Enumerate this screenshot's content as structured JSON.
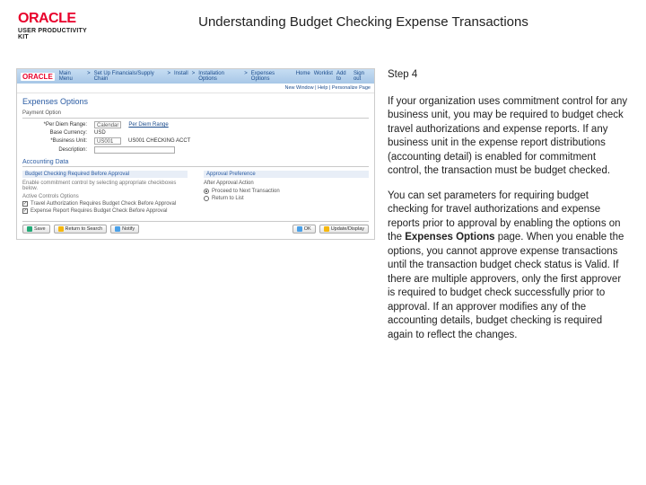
{
  "header": {
    "brand": "ORACLE",
    "subbrand": "USER PRODUCTIVITY KIT",
    "title": "Understanding Budget Checking Expense Transactions"
  },
  "instruction": {
    "step_label": "Step 4",
    "para1": "If your organization uses commitment control for any business unit, you may be required to budget check travel authorizations and expense reports. If any business unit in the expense report distributions (accounting detail) is enabled for commitment control, the transaction must be budget checked.",
    "para2a": "You can set parameters for requiring budget checking for travel authorizations and expense reports prior to approval by enabling the options on the ",
    "para2b": "Expenses Options",
    "para2c": " page. When you enable the options, you cannot approve expense transactions until the transaction budget check status is Valid. If there are multiple approvers, only the first approver is required to budget check successfully prior to approval. If an approver modifies any of the accounting details, budget checking is required again to reflect the changes."
  },
  "screenshot": {
    "topnav": {
      "logo": "ORACLE",
      "links": [
        "Main Menu",
        "Set Up Financials/Supply Chain",
        "Install",
        "Installation Options",
        "Expenses Options"
      ],
      "right": [
        "Home",
        "Worklist",
        "Add to",
        "Sign out"
      ]
    },
    "breadcrumb": "New Window | Help | Personalize Page",
    "page_title": "Expenses Options",
    "payment_label": "Payment Option",
    "rows": {
      "per_diem_lbl": "*Per Diem Range:",
      "per_diem_val": "Calendar",
      "per_diem_link": "Per Diem Range",
      "base_cur_lbl": "Base Currency:",
      "base_cur_val": "USD",
      "bu_lbl": "*Business Unit:",
      "bu_val": "US001",
      "bu_name": "US001 CHECKING ACCT",
      "desc_lbl": "Description:",
      "desc_val": ""
    },
    "acct_section": "Accounting Data",
    "budget_bar": "Budget Checking Required Before Approval",
    "approval_bar": "Approval Preference",
    "left_col": {
      "note": "Enable commitment control by selecting appropriate checkboxes below.",
      "note2": "Active Controls Options",
      "chk1": "Travel Authorization Requires Budget Check Before Approval",
      "chk2": "Expense Report Requires Budget Check Before Approval"
    },
    "right_col": {
      "header": "After Approval Action",
      "opt1": "Proceed to Next Transaction",
      "opt2": "Return to List"
    },
    "buttons": {
      "save": "Save",
      "return": "Return to Search",
      "notify": "Notify",
      "ok": "OK",
      "update": "Update/Display"
    }
  }
}
